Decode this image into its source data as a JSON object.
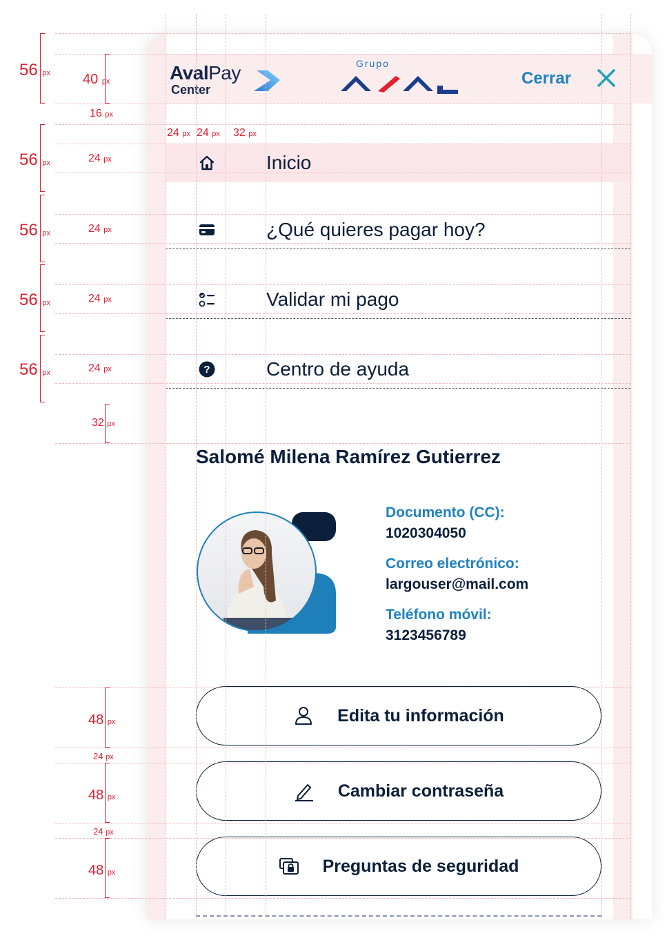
{
  "spec": {
    "left_annotations": [
      "56",
      "56",
      "56",
      "56",
      "56"
    ],
    "inner_annotations": [
      "40",
      "16",
      "24",
      "24",
      "24",
      "24",
      "32",
      "48",
      "24",
      "48",
      "24",
      "48"
    ],
    "column_annotations": [
      "24",
      "24",
      "32"
    ],
    "unit": "px",
    "guide_color": "#e0202f"
  },
  "header": {
    "brand_bold": "Aval",
    "brand_light": "Pay",
    "brand_sub": "Center",
    "group_label": "Grupo",
    "close_label": "Cerrar"
  },
  "menu": {
    "items": [
      {
        "label": "Inicio",
        "icon": "home-icon"
      },
      {
        "label": "¿Qué quieres pagar hoy?",
        "icon": "card-icon"
      },
      {
        "label": "Validar mi pago",
        "icon": "checklist-icon"
      },
      {
        "label": "Centro de ayuda",
        "icon": "help-icon"
      }
    ]
  },
  "profile": {
    "name": "Salomé Milena Ramírez Gutierrez",
    "document_label": "Documento (CC):",
    "document_value": "1020304050",
    "email_label": "Correo electrónico:",
    "email_value": "largouser@mail.com",
    "phone_label": "Teléfono móvil:",
    "phone_value": "3123456789"
  },
  "actions": {
    "edit": "Edita tu información",
    "password": "Cambiar contraseña",
    "security": "Preguntas de seguridad"
  },
  "colors": {
    "accent": "#1f82c0",
    "navy": "#0b1f3a",
    "highlight": "#fbe6e9",
    "aval_red": "#e0202f"
  }
}
